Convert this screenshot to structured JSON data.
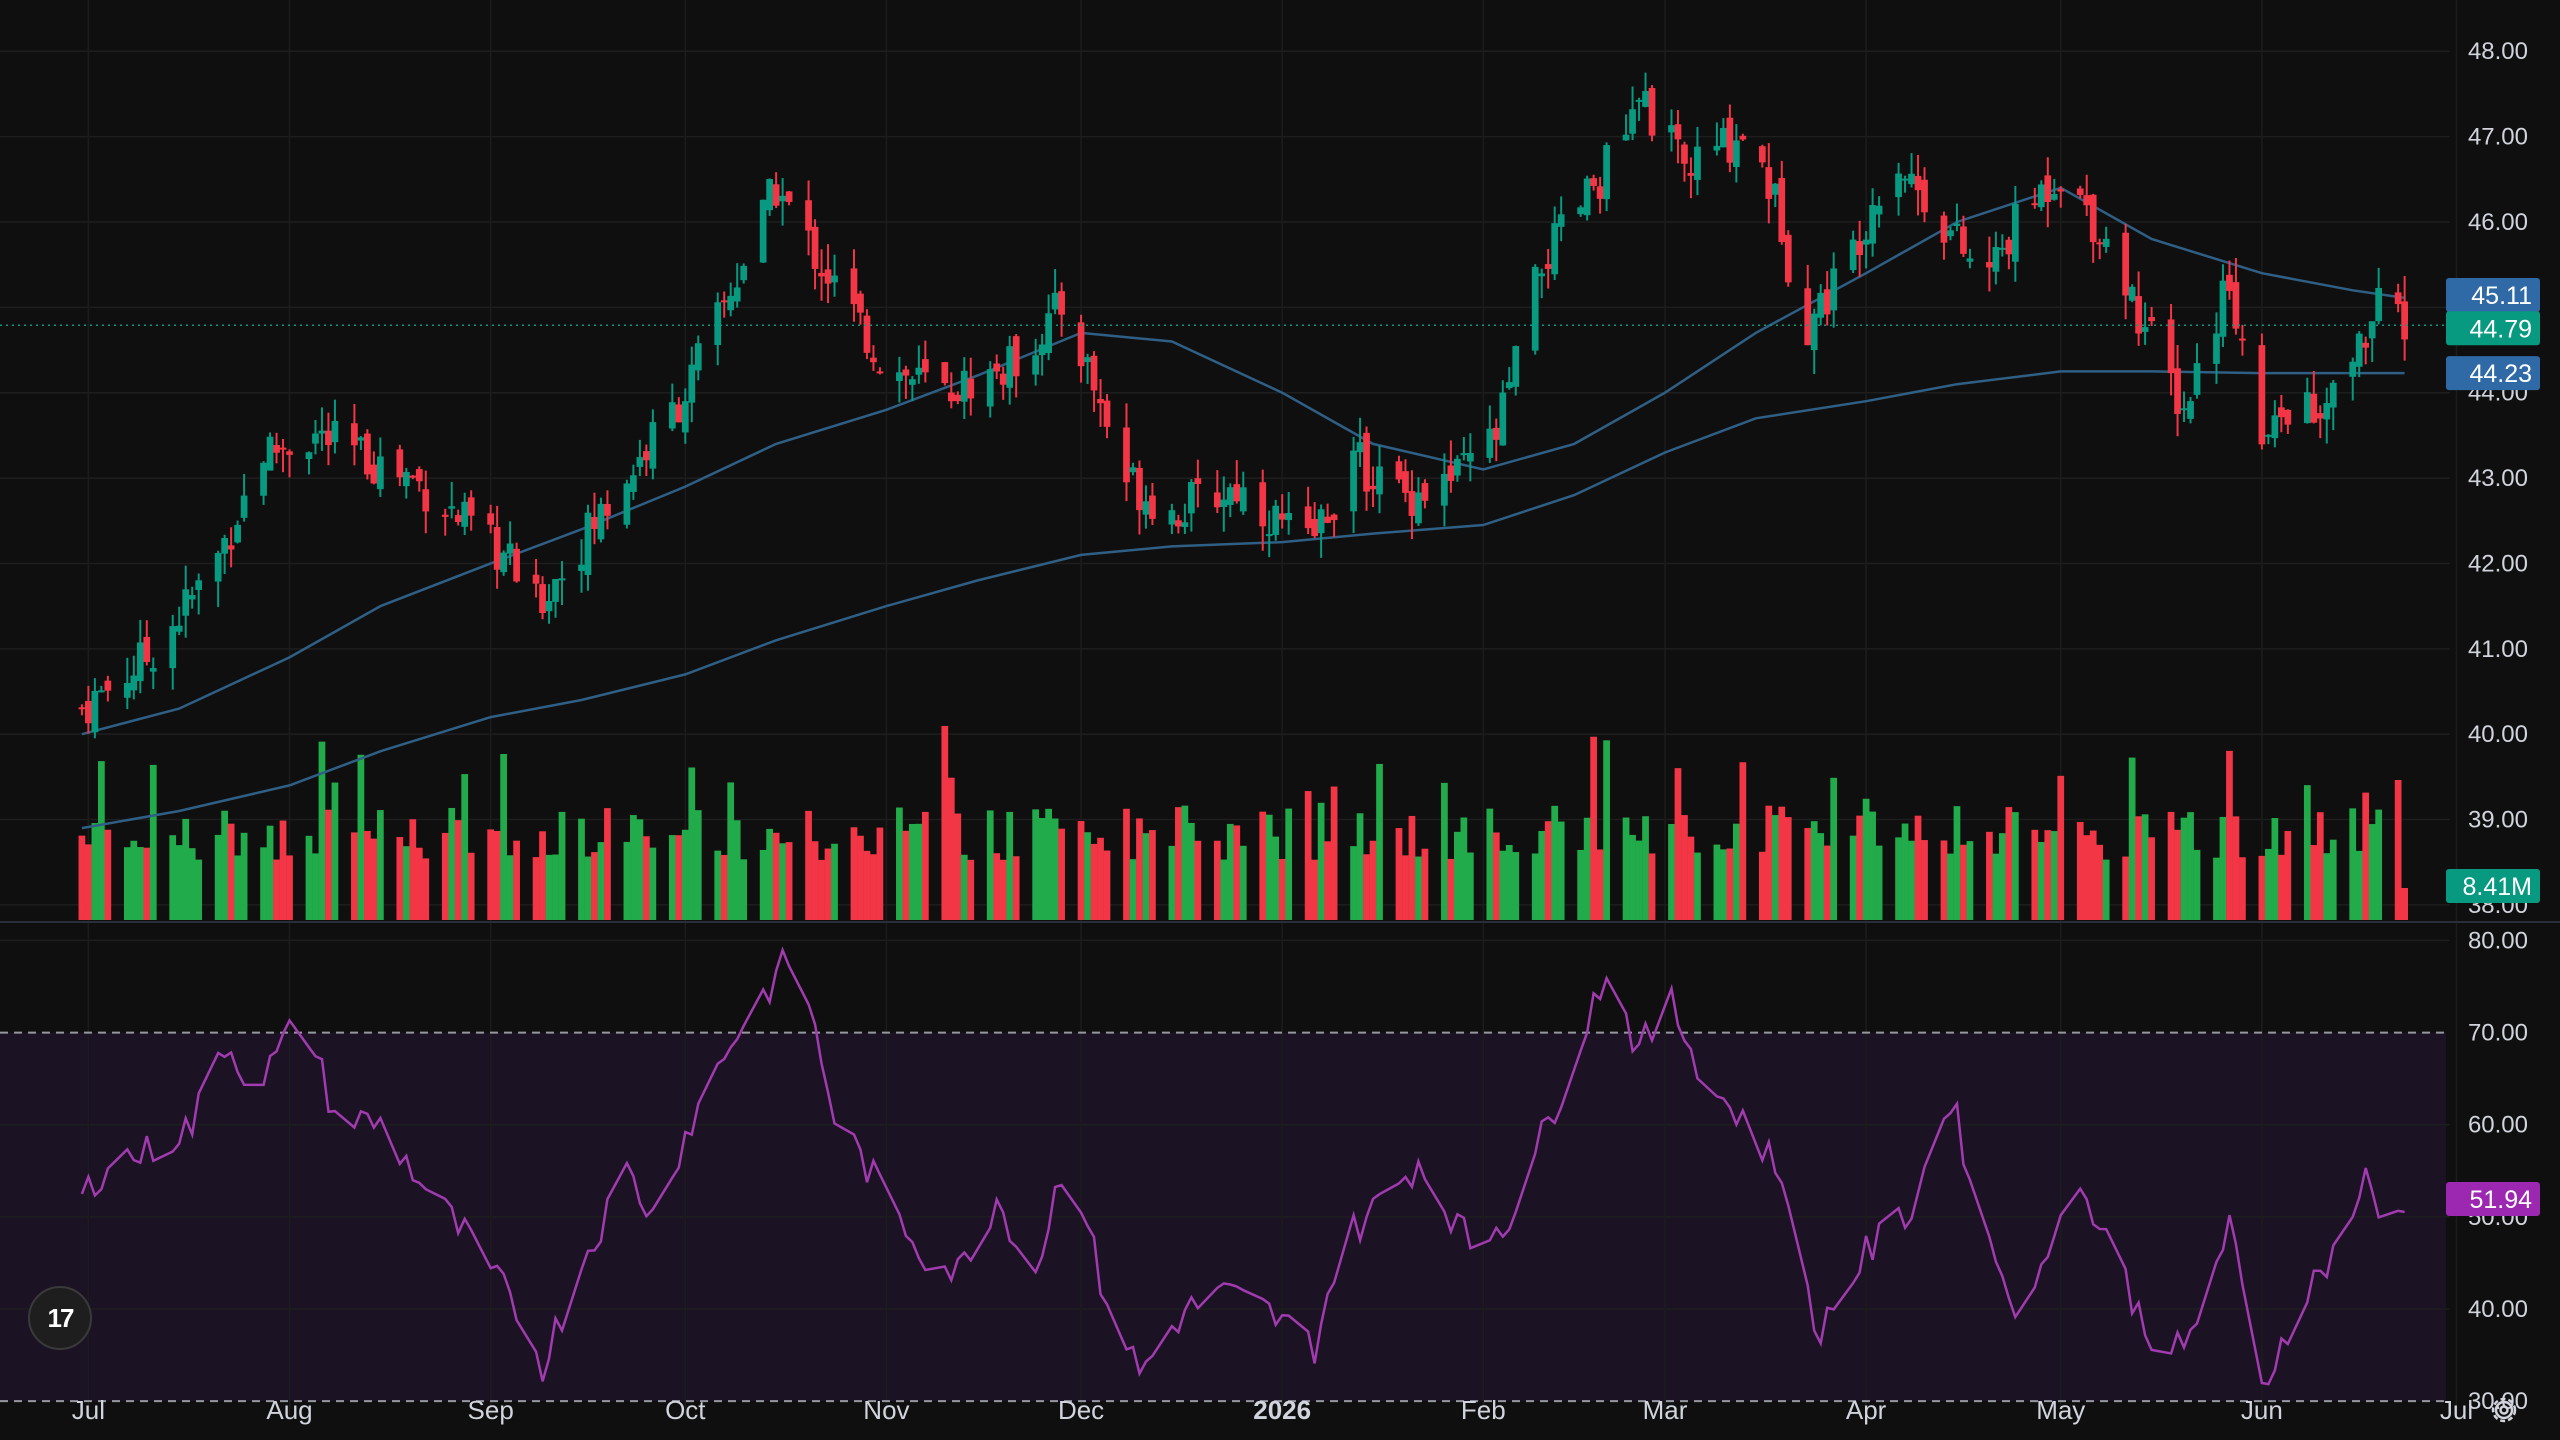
{
  "chart_data": [
    {
      "type": "candlestick",
      "title": "",
      "xaxis": {
        "ticks": [
          {
            "label": "Jul",
            "date": "2025-07-01"
          },
          {
            "label": "Aug",
            "date": "2025-08-01"
          },
          {
            "label": "Sep",
            "date": "2025-09-01"
          },
          {
            "label": "Oct",
            "date": "2025-10-01"
          },
          {
            "label": "Nov",
            "date": "2025-11-01"
          },
          {
            "label": "Dec",
            "date": "2025-12-01"
          },
          {
            "label": "2026",
            "date": "2026-01-01",
            "bold": true
          },
          {
            "label": "Feb",
            "date": "2026-02-01"
          },
          {
            "label": "Mar",
            "date": "2026-03-01"
          },
          {
            "label": "Apr",
            "date": "2026-04-01"
          },
          {
            "label": "May",
            "date": "2026-05-01"
          },
          {
            "label": "Jun",
            "date": "2026-06-01"
          },
          {
            "label": "Jul",
            "date": "2026-07-01"
          }
        ]
      },
      "yaxis": {
        "range": [
          37.8,
          48.6
        ],
        "ticks": [
          "38.00",
          "39.00",
          "40.00",
          "41.00",
          "42.00",
          "43.00",
          "44.00",
          "45.00",
          "46.00",
          "47.00",
          "48.00"
        ]
      },
      "last_price": {
        "value": "44.79",
        "color": "#089981"
      },
      "ma_tags": [
        {
          "value": "45.11",
          "color": "#2f6aa6"
        },
        {
          "value": "44.23",
          "color": "#2f6aa6"
        }
      ],
      "series": [
        {
          "name": "",
          "kind": "ma",
          "color": "#2f5f84",
          "points": [
            [
              "2025-06-30",
              40.0
            ],
            [
              "2025-07-15",
              40.3
            ],
            [
              "2025-08-01",
              40.9
            ],
            [
              "2025-08-15",
              41.5
            ],
            [
              "2025-09-01",
              42.0
            ],
            [
              "2025-09-15",
              42.4
            ],
            [
              "2025-10-01",
              42.9
            ],
            [
              "2025-10-15",
              43.4
            ],
            [
              "2025-11-01",
              43.8
            ],
            [
              "2025-11-15",
              44.2
            ],
            [
              "2025-12-01",
              44.7
            ],
            [
              "2025-12-15",
              44.6
            ],
            [
              "2026-01-01",
              44.0
            ],
            [
              "2026-01-15",
              43.4
            ],
            [
              "2026-02-01",
              43.1
            ],
            [
              "2026-02-15",
              43.4
            ],
            [
              "2026-03-01",
              44.0
            ],
            [
              "2026-03-15",
              44.7
            ],
            [
              "2026-04-01",
              45.4
            ],
            [
              "2026-04-15",
              46.0
            ],
            [
              "2026-05-01",
              46.4
            ],
            [
              "2026-05-15",
              45.8
            ],
            [
              "2026-06-01",
              45.4
            ],
            [
              "2026-06-15",
              45.2
            ],
            [
              "2026-06-23",
              45.11
            ]
          ]
        },
        {
          "name": "",
          "kind": "ma",
          "color": "#2f5f84",
          "points": [
            [
              "2025-06-30",
              38.9
            ],
            [
              "2025-07-15",
              39.1
            ],
            [
              "2025-08-01",
              39.4
            ],
            [
              "2025-08-15",
              39.8
            ],
            [
              "2025-09-01",
              40.2
            ],
            [
              "2025-09-15",
              40.4
            ],
            [
              "2025-10-01",
              40.7
            ],
            [
              "2025-10-15",
              41.1
            ],
            [
              "2025-11-01",
              41.5
            ],
            [
              "2025-11-15",
              41.8
            ],
            [
              "2025-12-01",
              42.1
            ],
            [
              "2025-12-15",
              42.2
            ],
            [
              "2026-01-01",
              42.25
            ],
            [
              "2026-01-15",
              42.35
            ],
            [
              "2026-02-01",
              42.45
            ],
            [
              "2026-02-15",
              42.8
            ],
            [
              "2026-03-01",
              43.3
            ],
            [
              "2026-03-15",
              43.7
            ],
            [
              "2026-04-01",
              43.9
            ],
            [
              "2026-04-15",
              44.1
            ],
            [
              "2026-05-01",
              44.25
            ],
            [
              "2026-05-15",
              44.25
            ],
            [
              "2026-06-01",
              44.23
            ],
            [
              "2026-06-15",
              44.23
            ],
            [
              "2026-06-23",
              44.23
            ]
          ]
        }
      ],
      "close_anchors": [
        [
          "2025-06-30",
          40.3
        ],
        [
          "2025-07-10",
          40.9
        ],
        [
          "2025-07-20",
          41.9
        ],
        [
          "2025-07-28",
          43.3
        ],
        [
          "2025-08-05",
          43.5
        ],
        [
          "2025-08-20",
          43.0
        ],
        [
          "2025-09-04",
          42.0
        ],
        [
          "2025-09-08",
          41.5
        ],
        [
          "2025-09-20",
          42.8
        ],
        [
          "2025-10-01",
          44.0
        ],
        [
          "2025-10-08",
          45.2
        ],
        [
          "2025-10-15",
          46.4
        ],
        [
          "2025-10-22",
          45.5
        ],
        [
          "2025-11-01",
          44.3
        ],
        [
          "2025-11-10",
          44.0
        ],
        [
          "2025-11-20",
          44.3
        ],
        [
          "2025-11-28",
          45.0
        ],
        [
          "2025-12-01",
          44.5
        ],
        [
          "2025-12-08",
          43.0
        ],
        [
          "2025-12-15",
          42.6
        ],
        [
          "2025-12-25",
          42.9
        ],
        [
          "2026-01-05",
          42.2
        ],
        [
          "2026-01-12",
          43.2
        ],
        [
          "2026-01-20",
          42.8
        ],
        [
          "2026-01-28",
          43.0
        ],
        [
          "2026-02-03",
          43.5
        ],
        [
          "2026-02-10",
          45.5
        ],
        [
          "2026-02-17",
          46.3
        ],
        [
          "2026-02-26",
          47.4
        ],
        [
          "2026-03-04",
          46.6
        ],
        [
          "2026-03-14",
          47.1
        ],
        [
          "2026-03-19",
          46.0
        ],
        [
          "2026-03-22",
          44.7
        ],
        [
          "2026-03-29",
          45.5
        ],
        [
          "2026-04-05",
          46.8
        ],
        [
          "2026-04-12",
          46.1
        ],
        [
          "2026-04-19",
          45.3
        ],
        [
          "2026-04-26",
          46.2
        ],
        [
          "2026-05-01",
          46.6
        ],
        [
          "2026-05-08",
          45.8
        ],
        [
          "2026-05-15",
          44.6
        ],
        [
          "2026-05-20",
          43.8
        ],
        [
          "2026-05-27",
          45.4
        ],
        [
          "2026-06-01",
          43.3
        ],
        [
          "2026-06-06",
          44.0
        ],
        [
          "2026-06-10",
          43.6
        ],
        [
          "2026-06-15",
          44.4
        ],
        [
          "2026-06-20",
          45.1
        ],
        [
          "2026-06-23",
          44.79
        ]
      ]
    },
    {
      "type": "bar",
      "title": "",
      "last_volume": {
        "value": "8.41M",
        "color": "#089981"
      },
      "colors": {
        "up": "#22ab4a",
        "down": "#f23645"
      }
    },
    {
      "type": "line",
      "title": "",
      "yaxis": {
        "range": [
          28.5,
          82
        ],
        "ticks": [
          "30.00",
          "40.00",
          "50.00",
          "60.00",
          "70.00",
          "80.00"
        ]
      },
      "bands": [
        30,
        70
      ],
      "color": "#a23ab0",
      "last": {
        "value": "51.94",
        "color": "#9c27b0"
      },
      "rsi_points": [
        [
          "2025-06-30",
          52
        ],
        [
          "2025-07-04",
          56
        ],
        [
          "2025-07-10",
          57
        ],
        [
          "2025-07-17",
          60
        ],
        [
          "2025-07-22",
          69
        ],
        [
          "2025-07-27",
          64
        ],
        [
          "2025-08-03",
          72
        ],
        [
          "2025-08-08",
          61
        ],
        [
          "2025-08-15",
          60
        ],
        [
          "2025-08-22",
          53
        ],
        [
          "2025-08-28",
          48
        ],
        [
          "2025-09-05",
          40
        ],
        [
          "2025-09-09",
          34
        ],
        [
          "2025-09-15",
          45
        ],
        [
          "2025-09-22",
          55
        ],
        [
          "2025-09-26",
          50
        ],
        [
          "2025-10-01",
          59
        ],
        [
          "2025-10-08",
          69
        ],
        [
          "2025-10-13",
          74
        ],
        [
          "2025-10-18",
          79
        ],
        [
          "2025-10-24",
          61
        ],
        [
          "2025-11-01",
          52
        ],
        [
          "2025-11-07",
          46
        ],
        [
          "2025-11-12",
          44
        ],
        [
          "2025-11-18",
          52
        ],
        [
          "2025-11-24",
          44
        ],
        [
          "2025-11-29",
          58
        ],
        [
          "2025-12-04",
          43
        ],
        [
          "2025-12-10",
          33
        ],
        [
          "2025-12-16",
          39
        ],
        [
          "2025-12-22",
          42
        ],
        [
          "2025-12-29",
          40
        ],
        [
          "2026-01-06",
          36
        ],
        [
          "2026-01-10",
          47
        ],
        [
          "2026-01-18",
          53
        ],
        [
          "2026-01-22",
          56
        ],
        [
          "2026-01-30",
          47
        ],
        [
          "2026-02-05",
          50
        ],
        [
          "2026-02-12",
          62
        ],
        [
          "2026-02-20",
          77
        ],
        [
          "2026-02-25",
          68
        ],
        [
          "2026-03-02",
          73
        ],
        [
          "2026-03-08",
          64
        ],
        [
          "2026-03-14",
          60
        ],
        [
          "2026-03-20",
          53
        ],
        [
          "2026-03-24",
          37
        ],
        [
          "2026-04-01",
          46
        ],
        [
          "2026-04-08",
          51
        ],
        [
          "2026-04-14",
          63
        ],
        [
          "2026-04-20",
          47
        ],
        [
          "2026-04-26",
          38
        ],
        [
          "2026-05-02",
          55
        ],
        [
          "2026-05-08",
          48
        ],
        [
          "2026-05-14",
          38
        ],
        [
          "2026-05-20",
          35
        ],
        [
          "2026-05-27",
          49
        ],
        [
          "2026-06-01",
          31
        ],
        [
          "2026-06-06",
          40
        ],
        [
          "2026-06-12",
          46
        ],
        [
          "2026-06-17",
          54
        ],
        [
          "2026-06-20",
          48
        ],
        [
          "2026-06-23",
          51.94
        ]
      ]
    }
  ],
  "branding": {
    "logo_text": "17",
    "logo_icon": "tradingview-logo-icon"
  },
  "controls": {
    "settings_icon": "gear-icon"
  }
}
